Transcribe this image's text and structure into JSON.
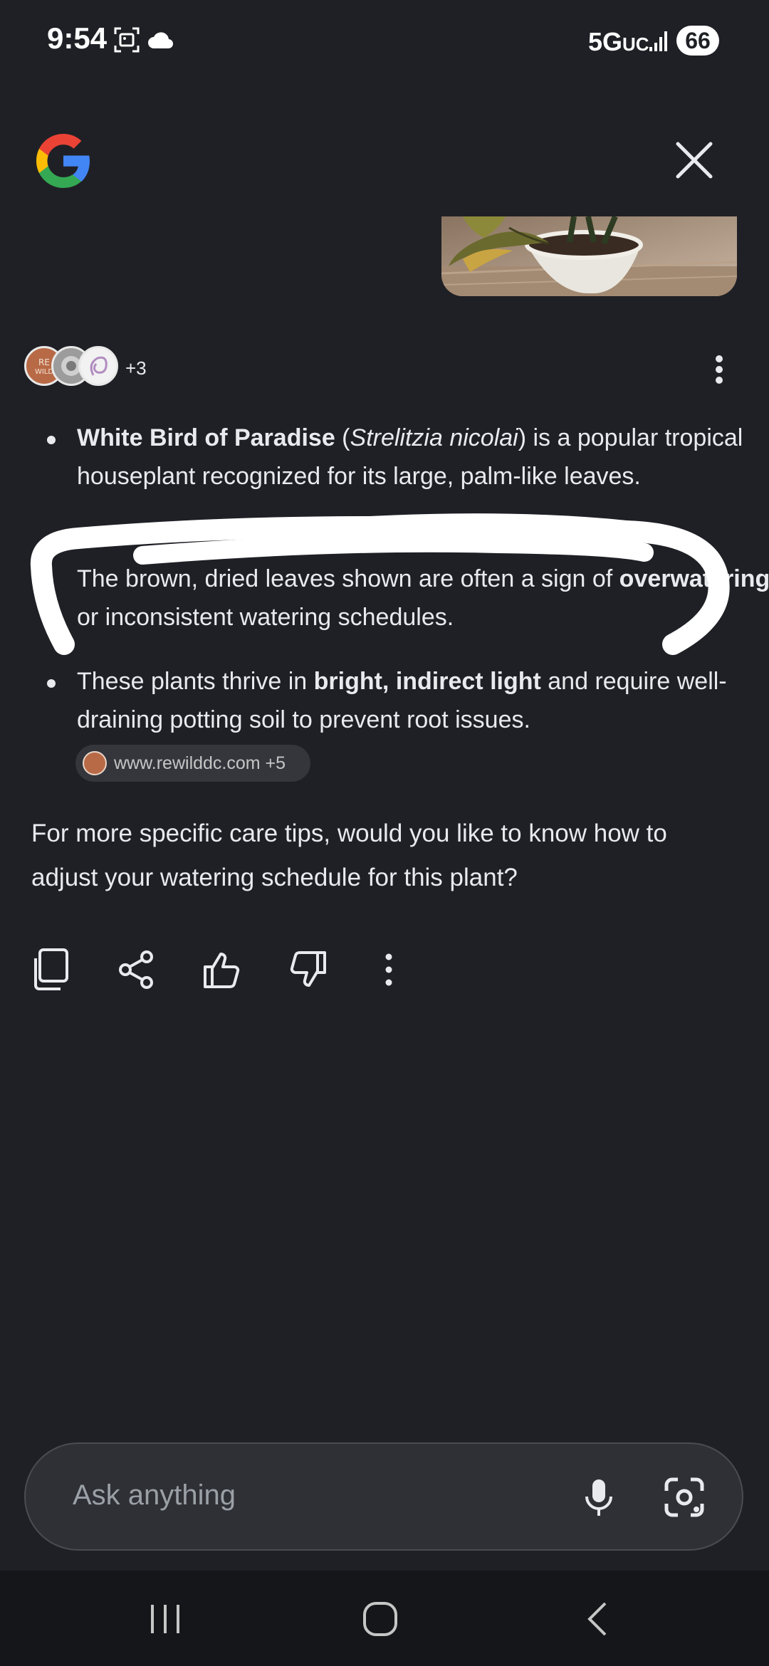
{
  "status_bar": {
    "time": "9:54",
    "network": "5G",
    "network_suffix": "UC",
    "battery": "66"
  },
  "sources": {
    "more_count": "+3"
  },
  "answer": {
    "bullet1": {
      "bold": "White Bird of Paradise",
      "paren_open": " (",
      "italic": "Strelitzia nicolai",
      "rest": ") is a popular tropical houseplant recognized for its large, palm-like leaves."
    },
    "bullet2": {
      "text1": "The brown, dried leaves shown are often a sign of ",
      "bold": "overwatering",
      "text2": " or inconsistent watering schedules."
    },
    "bullet3": {
      "text1": "These plants thrive in ",
      "bold": "bright, indirect light",
      "text2": " and require well-draining potting soil to prevent root issues."
    },
    "source_chip": "www.rewilddc.com +5",
    "followup": "For more specific care tips, would you like to know how to adjust your watering schedule for this plant?"
  },
  "ask_bar": {
    "placeholder": "Ask anything"
  },
  "colors": {
    "background": "#1f2025",
    "text": "#e8eaed",
    "ask_bar": "#2f3036",
    "nav_bar": "#151619"
  }
}
